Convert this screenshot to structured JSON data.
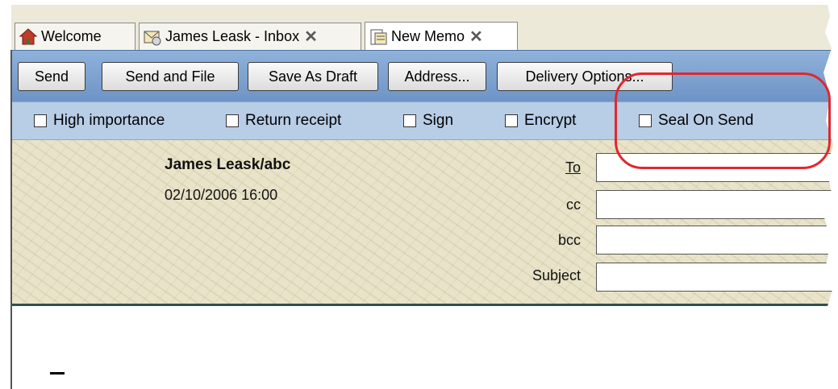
{
  "tabs": [
    {
      "label": "Welcome",
      "icon": "home-icon",
      "closable": false,
      "active": false
    },
    {
      "label": "James Leask - Inbox",
      "icon": "inbox-icon",
      "closable": true,
      "active": false
    },
    {
      "label": "New Memo",
      "icon": "memo-icon",
      "closable": true,
      "active": true
    }
  ],
  "toolbar": {
    "send": "Send",
    "send_and_file": "Send and File",
    "save_as_draft": "Save As Draft",
    "address": "Address...",
    "delivery_options": "Delivery Options..."
  },
  "options": {
    "high_importance": "High importance",
    "return_receipt": "Return receipt",
    "sign": "Sign",
    "encrypt": "Encrypt",
    "seal_on_send": "Seal On Send"
  },
  "header": {
    "author": "James Leask/abc",
    "datetime": "02/10/2006 16:00",
    "to_label": "To",
    "cc_label": "cc",
    "bcc_label": "bcc",
    "subject_label": "Subject",
    "to_value": "",
    "cc_value": "",
    "bcc_value": "",
    "subject_value": ""
  },
  "colors": {
    "toolbar": "#7fa3d1",
    "options_bar": "#b8cde6",
    "header_bg": "#e9e4c9",
    "highlight": "#e0282e"
  }
}
